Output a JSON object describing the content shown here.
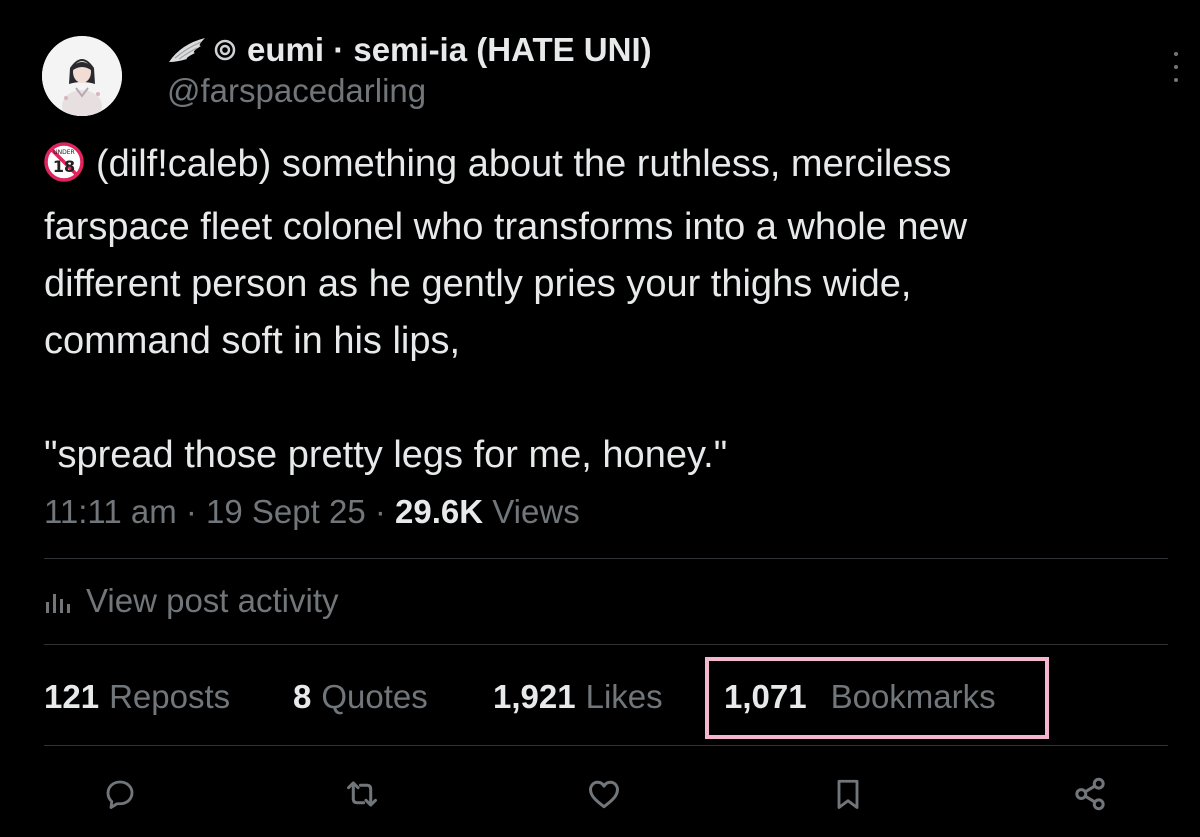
{
  "post": {
    "display_name": "eumi · semi-ia (HATE UNI)",
    "handle": "@farspacedarling",
    "body": {
      "emoji": "🔞",
      "line1": "(dilf!caleb) something about the ruthless, merciless",
      "line2": "farspace fleet colonel who transforms into a whole new",
      "line3": "different person as he gently pries your thighs wide,",
      "line4": "command soft in his lips,",
      "quote": "\"spread those pretty legs for me, honey.\""
    },
    "meta": {
      "time": "11:11 am",
      "date": "19 Sept 25",
      "views_count": "29.6K",
      "views_label": "Views",
      "separator": "·"
    },
    "activity_label": "View post activity",
    "stats": {
      "reposts": {
        "count": "121",
        "label": "Reposts"
      },
      "quotes": {
        "count": "8",
        "label": "Quotes"
      },
      "likes": {
        "count": "1,921",
        "label": "Likes"
      },
      "bookmarks": {
        "count": "1,071",
        "label": "Bookmarks"
      }
    },
    "highlight_color": "#f4b6cf"
  },
  "actions": [
    {
      "icon": "reply-icon"
    },
    {
      "icon": "repost-icon"
    },
    {
      "icon": "like-icon"
    },
    {
      "icon": "bookmark-icon"
    },
    {
      "icon": "share-icon"
    }
  ],
  "colors": {
    "background": "#000000",
    "text_primary": "#e7e9ea",
    "text_secondary": "#71767b",
    "divider": "#2f3336"
  }
}
